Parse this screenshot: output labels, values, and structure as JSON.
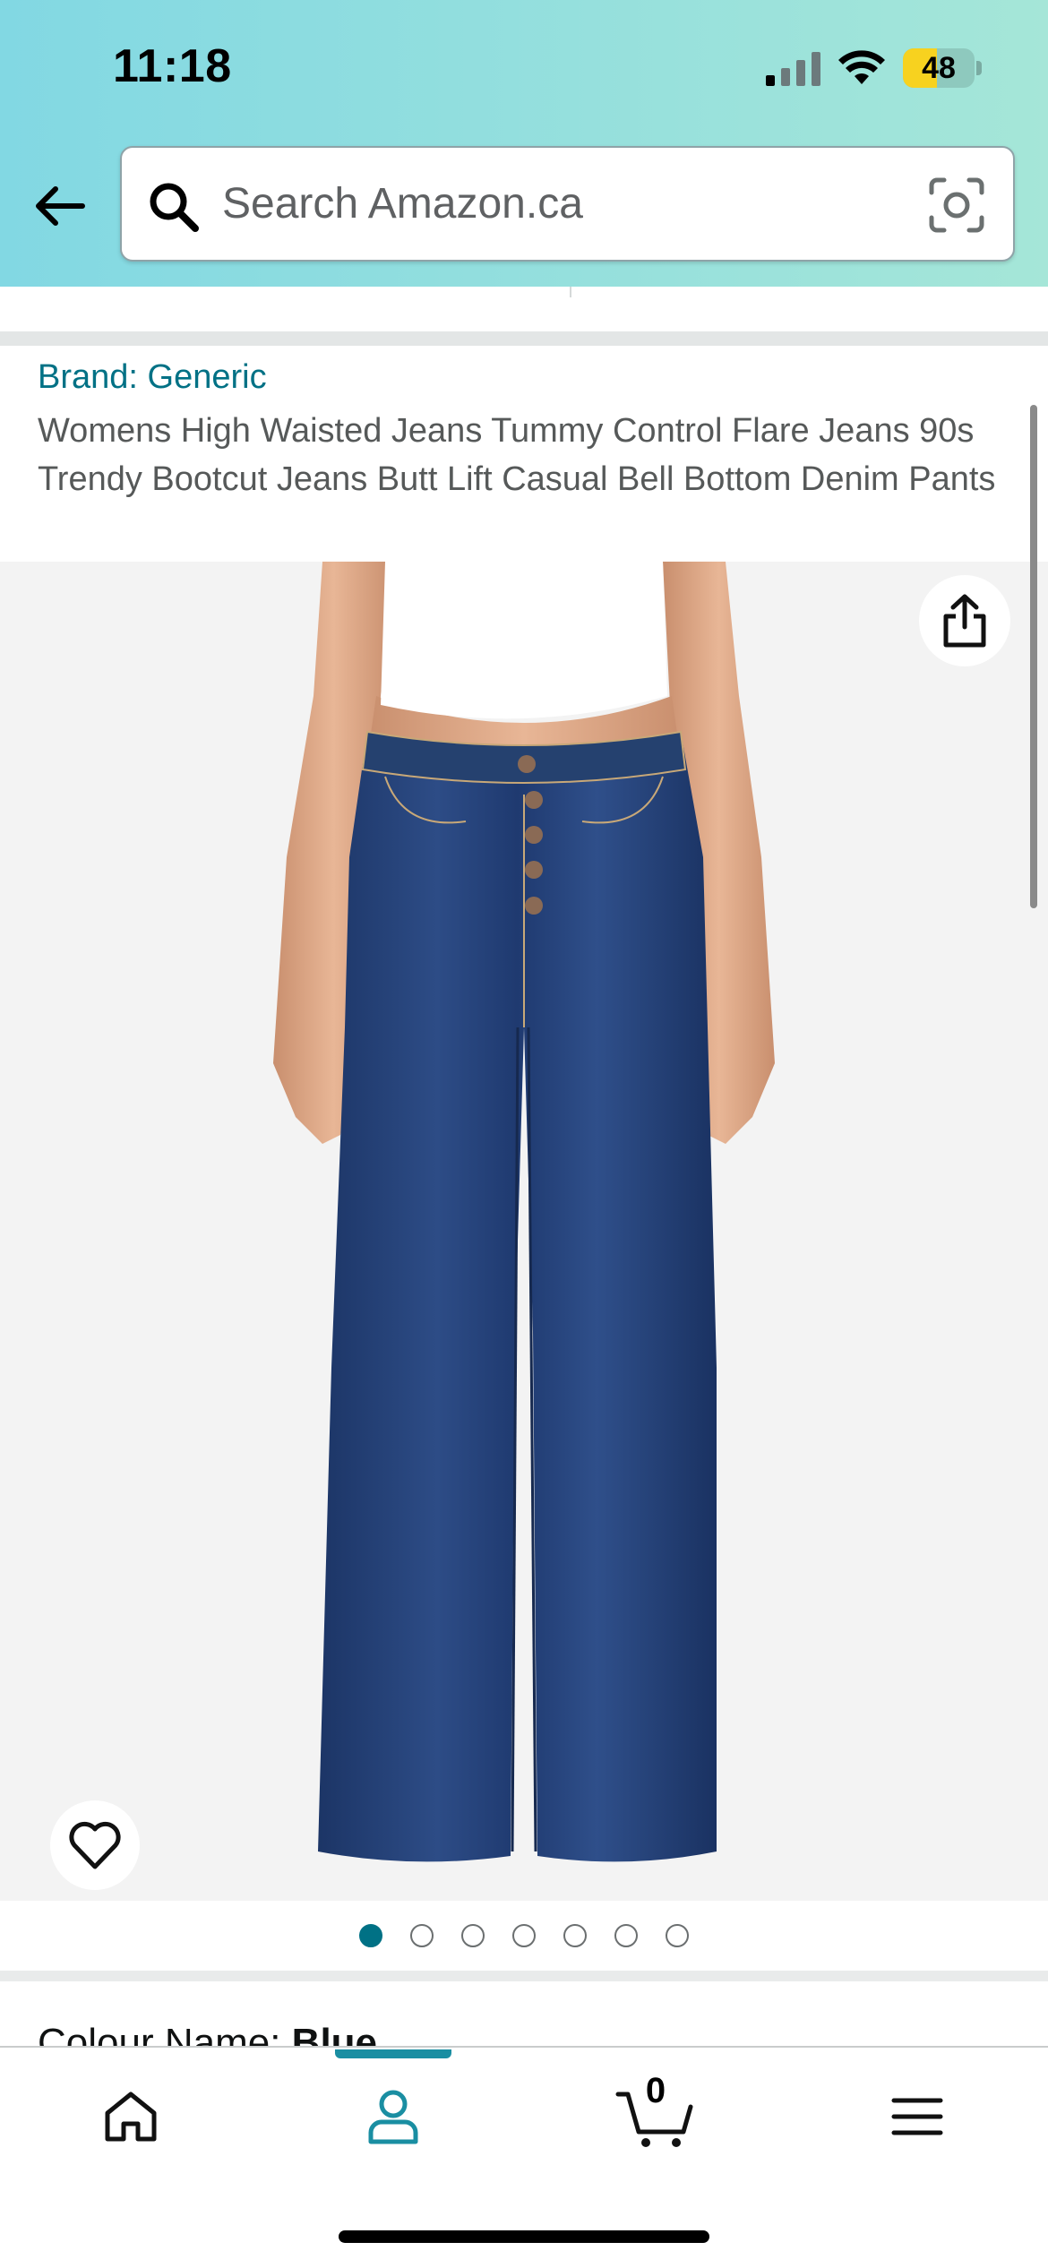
{
  "status_bar": {
    "time": "11:18",
    "battery": "48",
    "battery_level": 0.48
  },
  "header": {
    "search_placeholder": "Search Amazon.ca",
    "back_icon": "arrow-left-icon",
    "search_icon": "magnifier-icon",
    "camera_icon": "camera-lens-icon",
    "background_colors": [
      "#82d8e3",
      "#a5e6d8"
    ]
  },
  "product": {
    "brand_link": "Brand: Generic",
    "title": "Womens High Waisted Jeans Tummy Control Flare Jeans 90s Trendy Bootcut Jeans Butt Lift Casual Bell Bottom Denim Pants",
    "image_count": 7,
    "active_image_index": 0,
    "colour_label": "Colour Name: ",
    "colour_value": "Blue"
  },
  "bottom_nav": {
    "items": [
      {
        "icon": "home-icon"
      },
      {
        "icon": "account-icon",
        "active": true
      },
      {
        "icon": "cart-icon",
        "count": "0"
      },
      {
        "icon": "menu-icon"
      }
    ]
  },
  "colors": {
    "link": "#007185",
    "accent": "#1a8ea2",
    "battery": "#f7d21f"
  }
}
